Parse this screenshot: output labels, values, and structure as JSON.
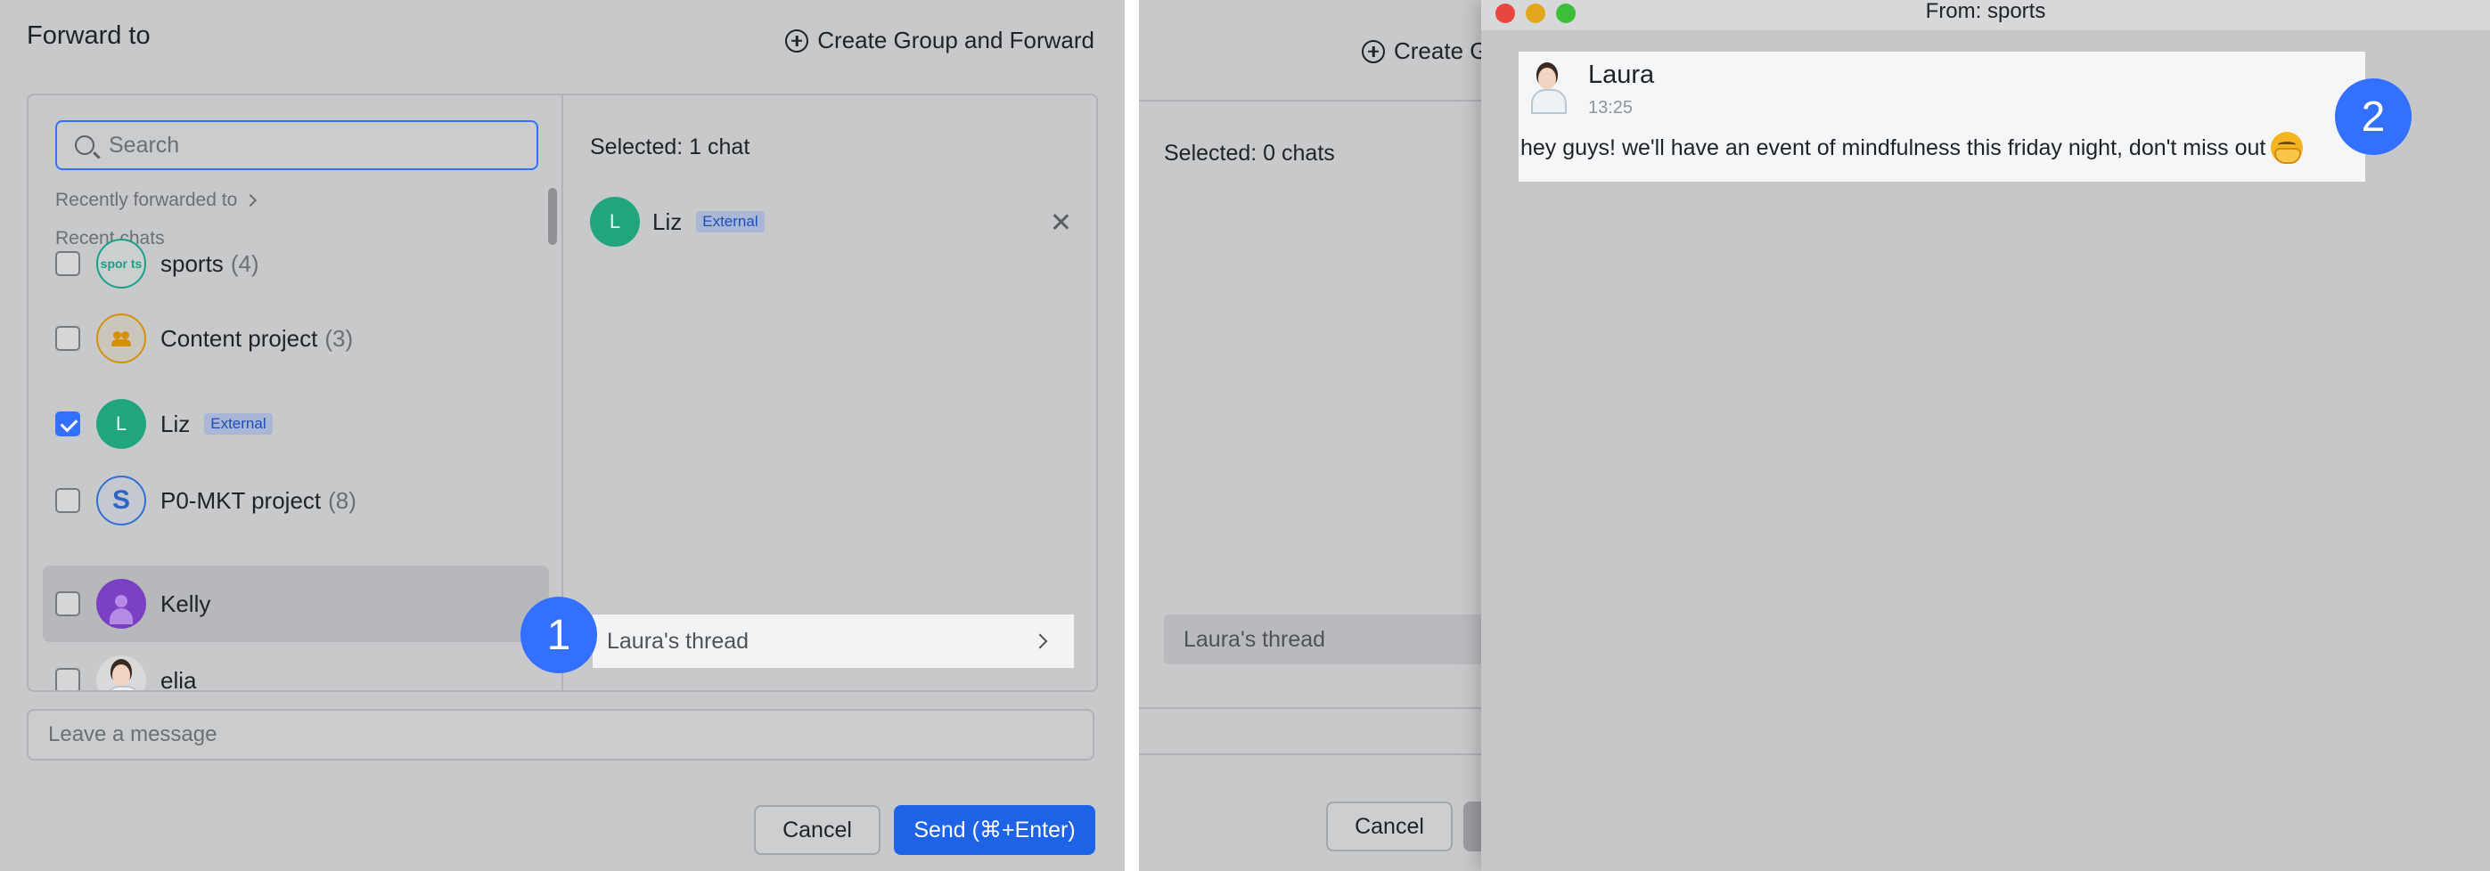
{
  "left_panel": {
    "title": "Forward to",
    "create_group_label": "Create Group and Forward",
    "search": {
      "placeholder": "Search"
    },
    "recently_forwarded_label": "Recently forwarded to",
    "recent_chats_label": "Recent chats",
    "chats": [
      {
        "name": "sports",
        "count": "(4)",
        "avatar_text": "spor ts",
        "checked": false
      },
      {
        "name": "Content project",
        "count": "(3)",
        "checked": false
      },
      {
        "name": "Liz",
        "badge": "External",
        "avatar_text": "L",
        "checked": true
      },
      {
        "name": "P0-MKT project",
        "count": "(8)",
        "avatar_text": "S",
        "checked": false
      },
      {
        "name": "Kelly",
        "checked": false
      },
      {
        "name": "elia",
        "checked": false
      }
    ],
    "selected": {
      "title": "Selected: 1 chat",
      "item": {
        "avatar_text": "L",
        "name": "Liz",
        "badge": "External"
      }
    },
    "thread_label": "Laura's thread",
    "step_badge": "1",
    "message_placeholder": "Leave a message",
    "cancel_label": "Cancel",
    "send_label": "Send (⌘+Enter)"
  },
  "right_panel": {
    "create_label_partial": "Create G",
    "selected_title": "Selected: 0 chats",
    "thread_label": "Laura's thread",
    "cancel_label": "Cancel",
    "window": {
      "title": "From: sports",
      "message": {
        "sender": "Laura",
        "time": "13:25",
        "text": "hey guys! we'll have an event of mindfulness this friday night, don't miss out"
      }
    },
    "step_badge": "2"
  },
  "colors": {
    "accent": "#3370ff",
    "send_button": "#1e62e6",
    "overlay_gray": "#c8c9cb",
    "liz_avatar": "#20a57f",
    "kelly_avatar": "#7b3fc4"
  }
}
